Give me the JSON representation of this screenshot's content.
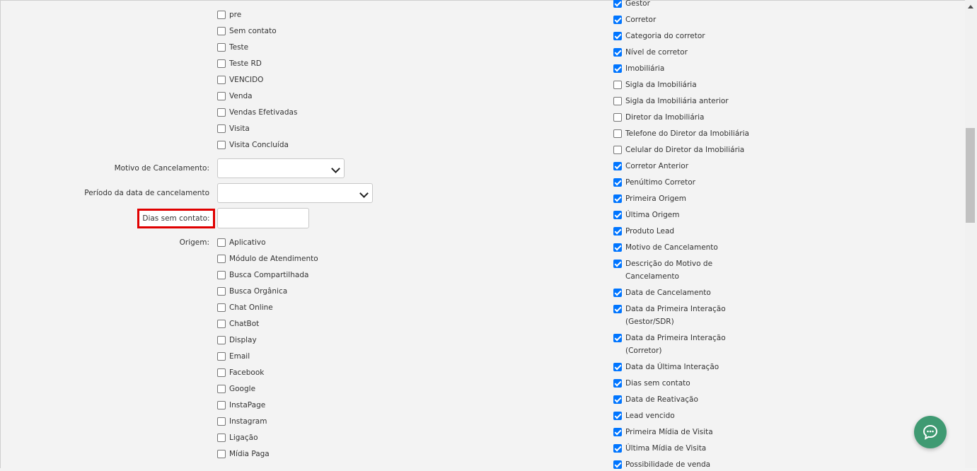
{
  "status_list": [
    {
      "label": "pre",
      "checked": false
    },
    {
      "label": "Sem contato",
      "checked": false
    },
    {
      "label": "Teste",
      "checked": false
    },
    {
      "label": "Teste RD",
      "checked": false
    },
    {
      "label": "VENCIDO",
      "checked": false
    },
    {
      "label": "Venda",
      "checked": false
    },
    {
      "label": "Vendas Efetivadas",
      "checked": false
    },
    {
      "label": "Visita",
      "checked": false
    },
    {
      "label": "Visita Concluída",
      "checked": false
    }
  ],
  "filters": {
    "motivo_cancelamento_label": "Motivo de Cancelamento:",
    "periodo_cancelamento_label": "Período da data de cancelamento",
    "dias_sem_contato_label": "Dias sem contato:",
    "origem_label": "Origem:"
  },
  "origem_list": [
    {
      "label": "Aplicativo",
      "checked": false
    },
    {
      "label": "Módulo de Atendimento",
      "checked": false
    },
    {
      "label": "Busca Compartilhada",
      "checked": false
    },
    {
      "label": "Busca Orgânica",
      "checked": false
    },
    {
      "label": "Chat Online",
      "checked": false
    },
    {
      "label": "ChatBot",
      "checked": false
    },
    {
      "label": "Display",
      "checked": false
    },
    {
      "label": "Email",
      "checked": false
    },
    {
      "label": "Facebook",
      "checked": false
    },
    {
      "label": "Google",
      "checked": false
    },
    {
      "label": "InstaPage",
      "checked": false
    },
    {
      "label": "Instagram",
      "checked": false
    },
    {
      "label": "Ligação",
      "checked": false
    },
    {
      "label": "Mídia Paga",
      "checked": false
    }
  ],
  "columns_list": [
    {
      "label": "Gestor",
      "checked": true
    },
    {
      "label": "Corretor",
      "checked": true
    },
    {
      "label": "Categoria do corretor",
      "checked": true
    },
    {
      "label": "Nível de corretor",
      "checked": true
    },
    {
      "label": "Imobiliária",
      "checked": true
    },
    {
      "label": "Sigla da Imobiliária",
      "checked": false
    },
    {
      "label": "Sigla da Imobiliária anterior",
      "checked": false
    },
    {
      "label": "Diretor da Imobiliária",
      "checked": false
    },
    {
      "label": "Telefone do Diretor da Imobiliária",
      "checked": false
    },
    {
      "label": "Celular do Diretor da Imobiliária",
      "checked": false
    },
    {
      "label": "Corretor Anterior",
      "checked": true
    },
    {
      "label": "Penúltimo Corretor",
      "checked": true
    },
    {
      "label": "Primeira Origem",
      "checked": true
    },
    {
      "label": "Última Origem",
      "checked": true
    },
    {
      "label": "Produto Lead",
      "checked": true
    },
    {
      "label": "Motivo de Cancelamento",
      "checked": true
    },
    {
      "label": "Descrição do Motivo de Cancelamento",
      "checked": true
    },
    {
      "label": "Data de Cancelamento",
      "checked": true
    },
    {
      "label": "Data da Primeira Interação (Gestor/SDR)",
      "checked": true
    },
    {
      "label": "Data da Primeira Interação (Corretor)",
      "checked": true
    },
    {
      "label": "Data da Última Interação",
      "checked": true
    },
    {
      "label": "Dias sem contato",
      "checked": true
    },
    {
      "label": "Data de Reativação",
      "checked": true
    },
    {
      "label": "Lead vencido",
      "checked": true
    },
    {
      "label": "Primeira Mídia de Visita",
      "checked": true
    },
    {
      "label": "Última Mídia de Visita",
      "checked": true
    },
    {
      "label": "Possibilidade de venda",
      "checked": true
    }
  ],
  "colors": {
    "accent": "#0075ff",
    "highlight": "#e00000",
    "chat": "#3f9a72"
  },
  "icons": {
    "chat": "chat-bubble-icon",
    "dropdown": "chevron-down-icon"
  }
}
